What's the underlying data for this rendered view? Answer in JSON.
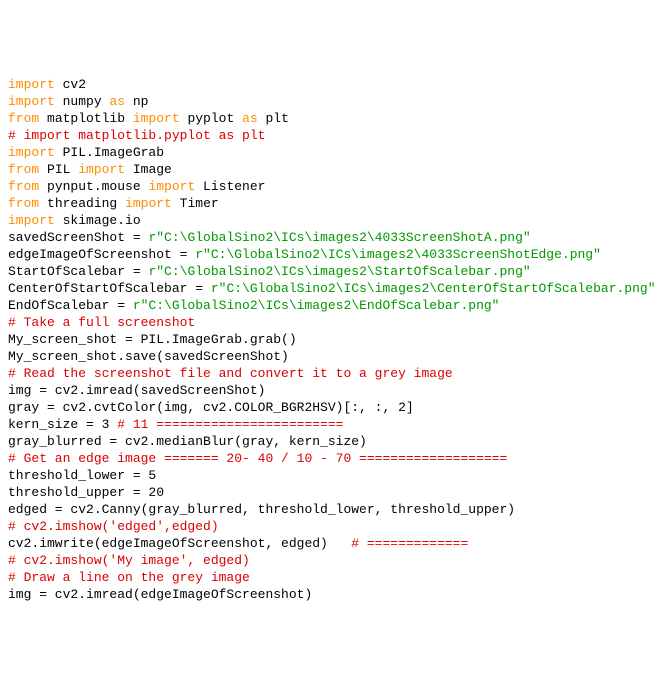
{
  "code": {
    "lines": [
      {
        "tokens": [
          {
            "cls": "kw",
            "t": "import"
          },
          {
            "cls": "plain",
            "t": " cv2"
          }
        ]
      },
      {
        "tokens": [
          {
            "cls": "kw",
            "t": "import"
          },
          {
            "cls": "plain",
            "t": " numpy "
          },
          {
            "cls": "kw",
            "t": "as"
          },
          {
            "cls": "plain",
            "t": " np"
          }
        ]
      },
      {
        "tokens": [
          {
            "cls": "kw",
            "t": "from"
          },
          {
            "cls": "plain",
            "t": " matplotlib "
          },
          {
            "cls": "kw",
            "t": "import"
          },
          {
            "cls": "plain",
            "t": " pyplot "
          },
          {
            "cls": "kw",
            "t": "as"
          },
          {
            "cls": "plain",
            "t": " plt"
          }
        ]
      },
      {
        "tokens": [
          {
            "cls": "cm",
            "t": "# import matplotlib.pyplot as plt"
          }
        ]
      },
      {
        "tokens": [
          {
            "cls": "kw",
            "t": "import"
          },
          {
            "cls": "plain",
            "t": " PIL.ImageGrab"
          }
        ]
      },
      {
        "tokens": [
          {
            "cls": "kw",
            "t": "from"
          },
          {
            "cls": "plain",
            "t": " PIL "
          },
          {
            "cls": "kw",
            "t": "import"
          },
          {
            "cls": "plain",
            "t": " Image"
          }
        ]
      },
      {
        "tokens": [
          {
            "cls": "kw",
            "t": "from"
          },
          {
            "cls": "plain",
            "t": " pynput.mouse "
          },
          {
            "cls": "kw",
            "t": "import"
          },
          {
            "cls": "plain",
            "t": " Listener"
          }
        ]
      },
      {
        "tokens": [
          {
            "cls": "kw",
            "t": "from"
          },
          {
            "cls": "plain",
            "t": " threading "
          },
          {
            "cls": "kw",
            "t": "import"
          },
          {
            "cls": "plain",
            "t": " Timer"
          }
        ]
      },
      {
        "tokens": [
          {
            "cls": "kw",
            "t": "import"
          },
          {
            "cls": "plain",
            "t": " skimage.io"
          }
        ]
      },
      {
        "tokens": [
          {
            "cls": "plain",
            "t": ""
          }
        ]
      },
      {
        "tokens": [
          {
            "cls": "plain",
            "t": "savedScreenShot = "
          },
          {
            "cls": "st",
            "t": "r\"C:\\GlobalSino2\\ICs\\images2\\4033ScreenShotA.png\""
          }
        ]
      },
      {
        "tokens": [
          {
            "cls": "plain",
            "t": "edgeImageOfScreenshot = "
          },
          {
            "cls": "st",
            "t": "r\"C:\\GlobalSino2\\ICs\\images2\\4033ScreenShotEdge.png\""
          }
        ]
      },
      {
        "tokens": [
          {
            "cls": "plain",
            "t": "StartOfScalebar = "
          },
          {
            "cls": "st",
            "t": "r\"C:\\GlobalSino2\\ICs\\images2\\StartOfScalebar.png\""
          }
        ]
      },
      {
        "tokens": [
          {
            "cls": "plain",
            "t": "CenterOfStartOfScalebar = "
          },
          {
            "cls": "st",
            "t": "r\"C:\\GlobalSino2\\ICs\\images2\\CenterOfStartOfScalebar.png\""
          }
        ]
      },
      {
        "tokens": [
          {
            "cls": "plain",
            "t": "EndOfScalebar = "
          },
          {
            "cls": "st",
            "t": "r\"C:\\GlobalSino2\\ICs\\images2\\EndOfScalebar.png\""
          }
        ]
      },
      {
        "tokens": [
          {
            "cls": "plain",
            "t": ""
          }
        ]
      },
      {
        "tokens": [
          {
            "cls": "cm",
            "t": "# Take a full screenshot"
          }
        ]
      },
      {
        "tokens": [
          {
            "cls": "plain",
            "t": "My_screen_shot = PIL.ImageGrab.grab()"
          }
        ]
      },
      {
        "tokens": [
          {
            "cls": "plain",
            "t": "My_screen_shot.save(savedScreenShot)"
          }
        ]
      },
      {
        "tokens": [
          {
            "cls": "plain",
            "t": ""
          }
        ]
      },
      {
        "tokens": [
          {
            "cls": "cm",
            "t": "# Read the screenshot file and convert it to a grey image"
          }
        ]
      },
      {
        "tokens": [
          {
            "cls": "plain",
            "t": "img = cv2.imread(savedScreenShot)"
          }
        ]
      },
      {
        "tokens": [
          {
            "cls": "plain",
            "t": "gray = cv2.cvtColor(img, cv2.COLOR_BGR2HSV)[:, :, 2]"
          }
        ]
      },
      {
        "tokens": [
          {
            "cls": "plain",
            "t": "kern_size = 3 "
          },
          {
            "cls": "cm",
            "t": "# 11 ========================"
          }
        ]
      },
      {
        "tokens": [
          {
            "cls": "plain",
            "t": "gray_blurred = cv2.medianBlur(gray, kern_size)"
          }
        ]
      },
      {
        "tokens": [
          {
            "cls": "plain",
            "t": ""
          }
        ]
      },
      {
        "tokens": [
          {
            "cls": "cm",
            "t": "# Get an edge image ======= 20- 40 / 10 - 70 ==================="
          }
        ]
      },
      {
        "tokens": [
          {
            "cls": "plain",
            "t": "threshold_lower = 5"
          }
        ]
      },
      {
        "tokens": [
          {
            "cls": "plain",
            "t": "threshold_upper = 20"
          }
        ]
      },
      {
        "tokens": [
          {
            "cls": "plain",
            "t": "edged = cv2.Canny(gray_blurred, threshold_lower, threshold_upper)"
          }
        ]
      },
      {
        "tokens": [
          {
            "cls": "plain",
            "t": ""
          }
        ]
      },
      {
        "tokens": [
          {
            "cls": "cm",
            "t": "# cv2.imshow('edged',edged)"
          }
        ]
      },
      {
        "tokens": [
          {
            "cls": "plain",
            "t": "cv2.imwrite(edgeImageOfScreenshot, edged)   "
          },
          {
            "cls": "cm",
            "t": "# ============="
          }
        ]
      },
      {
        "tokens": [
          {
            "cls": "cm",
            "t": "# cv2.imshow('My image', edged)"
          }
        ]
      },
      {
        "tokens": [
          {
            "cls": "plain",
            "t": ""
          }
        ]
      },
      {
        "tokens": [
          {
            "cls": "cm",
            "t": "# Draw a line on the grey image"
          }
        ]
      },
      {
        "tokens": [
          {
            "cls": "plain",
            "t": "img = cv2.imread(edgeImageOfScreenshot)"
          }
        ]
      }
    ]
  }
}
